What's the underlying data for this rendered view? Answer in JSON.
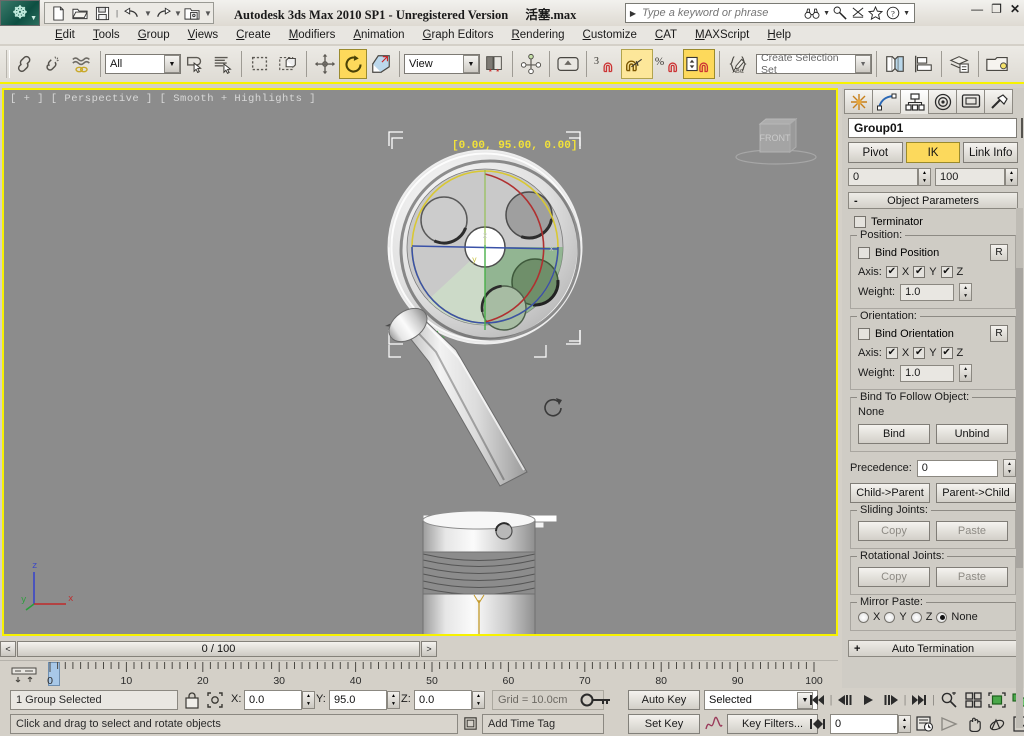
{
  "app": {
    "title": "Autodesk 3ds Max  2010 SP1  - Unregistered Version",
    "filename": "活塞.max",
    "logo_label": "3ds-max-logo"
  },
  "quick_access": {
    "items": [
      {
        "name": "new-file-icon",
        "label": "New"
      },
      {
        "name": "open-file-icon",
        "label": "Open"
      },
      {
        "name": "save-file-icon",
        "label": "Save"
      },
      {
        "name": "undo-icon",
        "label": "Undo"
      },
      {
        "name": "redo-icon",
        "label": "Redo"
      },
      {
        "name": "set-project-folder-icon",
        "label": "Set Project Folder"
      },
      {
        "name": "customize-qat-icon",
        "label": "Customize"
      }
    ]
  },
  "search": {
    "placeholder": "Type a keyword or phrase",
    "icons": [
      "binoculars-icon",
      "wrench-icon",
      "steering-icon",
      "star-icon",
      "help-icon"
    ]
  },
  "window_buttons": {
    "minimize": "—",
    "restore": "❐",
    "close": "✕"
  },
  "menu": {
    "items": [
      "Edit",
      "Tools",
      "Group",
      "Views",
      "Create",
      "Modifiers",
      "Animation",
      "Graph Editors",
      "Rendering",
      "Customize",
      "CAT",
      "MAXScript",
      "Help"
    ]
  },
  "toolbar": {
    "selection_filter": "All",
    "reference_coord": "View",
    "named_selection_set": "Create Selection Set",
    "angle_snap_value": "3",
    "percent_snap_label": "%",
    "buttons": [
      {
        "name": "select-and-link-icon",
        "active": false
      },
      {
        "name": "unlink-selection-icon",
        "active": false
      },
      {
        "name": "bind-to-space-warp-icon",
        "active": false
      },
      {
        "name": "select-object-icon",
        "active": false
      },
      {
        "name": "select-by-name-icon",
        "active": false
      },
      {
        "name": "rectangular-selection-region-icon",
        "active": false
      },
      {
        "name": "window-crossing-icon",
        "active": false
      },
      {
        "name": "select-and-move-icon",
        "active": false
      },
      {
        "name": "select-and-rotate-icon",
        "active": true
      },
      {
        "name": "select-and-scale-icon",
        "active": false
      },
      {
        "name": "use-pivot-point-center-icon",
        "active": false
      },
      {
        "name": "mirror-icon",
        "active": false
      },
      {
        "name": "align-icon",
        "active": false
      },
      {
        "name": "layer-manager-icon",
        "active": false
      },
      {
        "name": "material-editor-icon",
        "active": false
      },
      {
        "name": "snaps-toggle-icon",
        "active": false
      },
      {
        "name": "angle-snap-toggle-icon",
        "active": true
      },
      {
        "name": "percent-snap-toggle-icon",
        "active": false
      },
      {
        "name": "spinner-snap-toggle-icon",
        "active": true
      },
      {
        "name": "named-selection-sets-icon",
        "active": false
      }
    ]
  },
  "viewport": {
    "label": "[ + ] [ Perspective ] [ Smooth + Highlights ]",
    "coord_readout": "[0.00,  95.00,  0.00]",
    "viewcube_face": "FRONT",
    "axis_labels": {
      "x": "x",
      "y": "y",
      "z": "z"
    }
  },
  "command_panel": {
    "tabs": [
      {
        "name": "create-tab",
        "icon": "star-burst-icon",
        "selected": false
      },
      {
        "name": "modify-tab",
        "icon": "curve-icon",
        "selected": false
      },
      {
        "name": "hierarchy-tab",
        "icon": "hierarchy-tree-icon",
        "selected": true
      },
      {
        "name": "motion-tab",
        "icon": "target-circles-icon",
        "selected": false
      },
      {
        "name": "display-tab",
        "icon": "monitor-icon",
        "selected": false
      },
      {
        "name": "utilities-tab",
        "icon": "hammer-icon",
        "selected": false
      }
    ],
    "object_name": "Group01",
    "object_color": "#2222cc",
    "sub_tabs": [
      {
        "label": "Pivot",
        "active": false
      },
      {
        "label": "IK",
        "active": true
      },
      {
        "label": "Link Info",
        "active": false
      }
    ],
    "range_fields": [
      "0",
      "100"
    ],
    "rollouts": {
      "object_parameters": {
        "title": "Object Parameters",
        "expanded": true,
        "toggle": "-",
        "terminator": {
          "label": "Terminator",
          "checked": false
        },
        "position": {
          "title": "Position:",
          "bind_label": "Bind Position",
          "bind_checked": false,
          "reset_button": "R",
          "axis_label": "Axis:",
          "axes": [
            {
              "label": "X",
              "checked": true
            },
            {
              "label": "Y",
              "checked": true
            },
            {
              "label": "Z",
              "checked": true
            }
          ],
          "weight_label": "Weight:",
          "weight_value": "1.0"
        },
        "orientation": {
          "title": "Orientation:",
          "bind_label": "Bind Orientation",
          "bind_checked": false,
          "reset_button": "R",
          "axis_label": "Axis:",
          "axes": [
            {
              "label": "X",
              "checked": true
            },
            {
              "label": "Y",
              "checked": true
            },
            {
              "label": "Z",
              "checked": true
            }
          ],
          "weight_label": "Weight:",
          "weight_value": "1.0"
        },
        "bind_to_follow": {
          "title": "Bind To Follow Object:",
          "value": "None",
          "bind_button": "Bind",
          "unbind_button": "Unbind"
        },
        "precedence_label": "Precedence:",
        "precedence_value": "0",
        "child_to_parent": "Child->Parent",
        "parent_to_child": "Parent->Child",
        "sliding_joints": {
          "title": "Sliding Joints:",
          "copy": "Copy",
          "paste": "Paste"
        },
        "rotational_joints": {
          "title": "Rotational Joints:",
          "copy": "Copy",
          "paste": "Paste"
        },
        "mirror_paste": {
          "title": "Mirror Paste:",
          "options": [
            {
              "label": "X",
              "selected": false
            },
            {
              "label": "Y",
              "selected": false
            },
            {
              "label": "Z",
              "selected": false
            },
            {
              "label": "None",
              "selected": true
            }
          ]
        }
      },
      "auto_termination": {
        "title": "Auto Termination",
        "expanded": false,
        "toggle": "+"
      }
    }
  },
  "time_slider": {
    "prev_arrow": "<",
    "next_arrow": ">",
    "frame_label": "0 / 100"
  },
  "track_bar": {
    "tick_labels": [
      "0",
      "10",
      "20",
      "30",
      "40",
      "50",
      "60",
      "70",
      "80",
      "90",
      "100"
    ],
    "current_frame": 0
  },
  "status_bar": {
    "selection_status": "1 Group Selected",
    "lock_icon": "lock-selection-icon",
    "coord_icon": "absolute-relative-mode-icon",
    "x_label": "X:",
    "x_value": "0.0",
    "y_label": "Y:",
    "y_value": "95.0",
    "z_label": "Z:",
    "z_value": "0.0",
    "grid_text": "Grid = 10.0cm",
    "add_time_tag": "Add Time Tag",
    "prompt": "Click and drag to select and rotate objects",
    "key_mode_icon": "key-mode-icon"
  },
  "animation_controls": {
    "auto_key": "Auto Key",
    "set_key": "Set Key",
    "selection_list": "Selected",
    "key_filters": "Key Filters...",
    "current_frame": "0",
    "transport": [
      {
        "name": "goto-start-button",
        "glyph": "|◀◀"
      },
      {
        "name": "previous-frame-button",
        "glyph": "◀||"
      },
      {
        "name": "play-animation-button",
        "glyph": "▶"
      },
      {
        "name": "next-frame-button",
        "glyph": "||▶"
      },
      {
        "name": "goto-end-button",
        "glyph": "▶▶|"
      }
    ],
    "viewport_nav": [
      {
        "name": "zoom-button"
      },
      {
        "name": "zoom-all-button"
      },
      {
        "name": "zoom-extents-button"
      },
      {
        "name": "zoom-extents-all-button"
      },
      {
        "name": "field-of-view-button"
      },
      {
        "name": "pan-view-button"
      },
      {
        "name": "orbit-button"
      },
      {
        "name": "maximize-viewport-toggle-button"
      }
    ]
  }
}
